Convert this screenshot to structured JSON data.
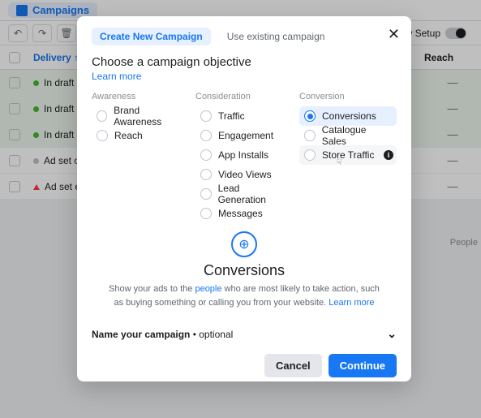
{
  "bg": {
    "campaigns_label": "Campaigns",
    "view_setup": "View Setup",
    "delivery_header": "Delivery",
    "reach_header": "Reach",
    "rows": [
      {
        "status": "In draft",
        "dot": "green",
        "dash": "—"
      },
      {
        "status": "In draft",
        "dot": "green",
        "dash": "—"
      },
      {
        "status": "In draft",
        "dot": "green",
        "dash": "—"
      },
      {
        "status": "Ad set on",
        "dot": "grey",
        "dash": "—"
      },
      {
        "status": "Ad set err",
        "dot": "tri",
        "dash": "—"
      }
    ],
    "results_label": "People"
  },
  "modal": {
    "tab_create": "Create New Campaign",
    "tab_existing": "Use existing campaign",
    "headline": "Choose a campaign objective",
    "learn_more": "Learn more",
    "sections": {
      "awareness": {
        "title": "Awareness",
        "opts": [
          "Brand Awareness",
          "Reach"
        ]
      },
      "consideration": {
        "title": "Consideration",
        "opts": [
          "Traffic",
          "Engagement",
          "App Installs",
          "Video Views",
          "Lead Generation",
          "Messages"
        ]
      },
      "conversion": {
        "title": "Conversion",
        "opts": [
          "Conversions",
          "Catalogue Sales",
          "Store Traffic"
        ]
      }
    },
    "selected_title": "Conversions",
    "desc_pre": "Show your ads to the ",
    "desc_link": "people",
    "desc_mid": " who are most likely to take action, such as buying something or calling you from your website. ",
    "desc_learn": "Learn more",
    "name_label": "Name your campaign ",
    "name_optional": "• optional",
    "cancel": "Cancel",
    "continue": "Continue"
  }
}
